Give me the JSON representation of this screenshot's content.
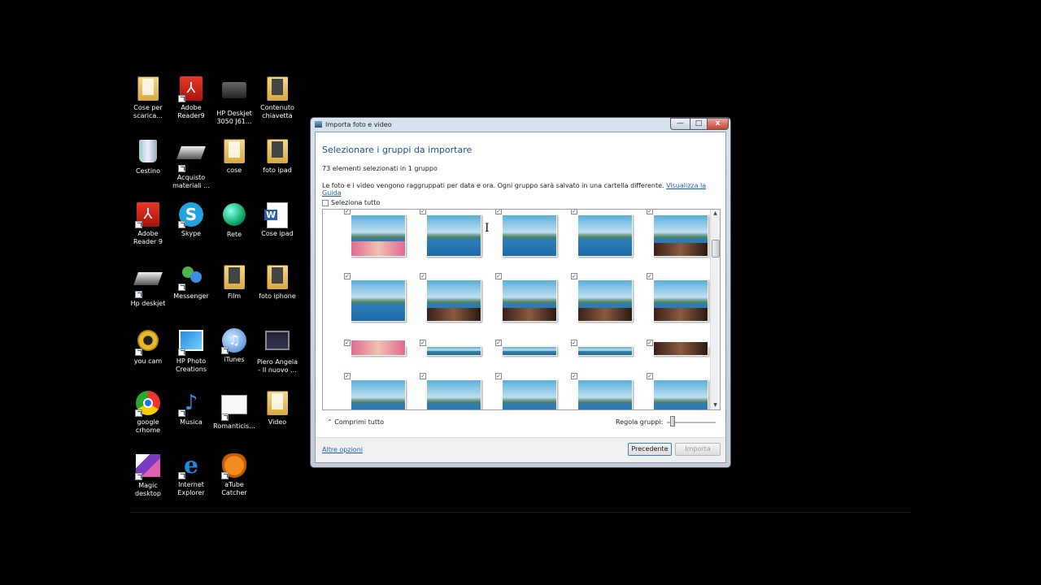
{
  "desktop": {
    "icons": [
      {
        "label": "Cose per\nscarica...",
        "icon": "folder-icon"
      },
      {
        "label": "Adobe\nReader9",
        "icon": "pdf-icon"
      },
      {
        "label": "HP Deskjet\n3050 J61...",
        "icon": "printer-icon"
      },
      {
        "label": "Contenuto\nchiavetta",
        "icon": "folder-icon"
      },
      {
        "label": "Cestino",
        "icon": "recycle-bin-icon"
      },
      {
        "label": "Acquisto\nmateriali ...",
        "icon": "scanner-icon"
      },
      {
        "label": "cose",
        "icon": "folder-icon"
      },
      {
        "label": "foto ipad",
        "icon": "folder-icon"
      },
      {
        "label": "Adobe\nReader 9",
        "icon": "pdf-icon"
      },
      {
        "label": "Skype",
        "icon": "skype-icon"
      },
      {
        "label": "Rete",
        "icon": "network-globe-icon"
      },
      {
        "label": "Cose ipad",
        "icon": "word-document-icon"
      },
      {
        "label": "Hp deskjet",
        "icon": "scanner-icon"
      },
      {
        "label": "Messenger",
        "icon": "messenger-icon"
      },
      {
        "label": "Film",
        "icon": "folder-icon"
      },
      {
        "label": "foto iphone",
        "icon": "folder-icon"
      },
      {
        "label": "you cam",
        "icon": "webcam-icon"
      },
      {
        "label": "HP Photo\nCreations",
        "icon": "photo-icon"
      },
      {
        "label": "iTunes",
        "icon": "itunes-icon"
      },
      {
        "label": "Piero Angela\n- Il nuovo ...",
        "icon": "video-file-icon"
      },
      {
        "label": "google\ncrhome",
        "icon": "chrome-icon"
      },
      {
        "label": "Musica",
        "icon": "music-icon"
      },
      {
        "label": "Romanticis...",
        "icon": "card-icon"
      },
      {
        "label": "Video",
        "icon": "folder-icon"
      },
      {
        "label": "Magic\ndesktop",
        "icon": "magic-desktop-icon"
      },
      {
        "label": "Internet\nExplorer",
        "icon": "internet-explorer-icon"
      },
      {
        "label": "aTube\nCatcher",
        "icon": "atube-icon"
      }
    ]
  },
  "window": {
    "title": "Importa foto e video",
    "minimize": "—",
    "maximize": "□",
    "close": "x",
    "heading": "Selezionare i gruppi da importare",
    "selected_count": "73 elementi selezionati in 1 gruppo",
    "info_text": "Le foto e i video vengono raggruppati per data e ora. Ogni gruppo sarà salvato in una cartella differente. ",
    "guide_link": "Visualizza la Guida",
    "select_all": "Seleziona tutto",
    "collapse_all": "Comprimi tutto",
    "adjust_groups": "Regola gruppi:",
    "more_options": "Altre opzioni",
    "previous": "Precedente",
    "import": "Importa",
    "thumbnails_checked": true
  }
}
